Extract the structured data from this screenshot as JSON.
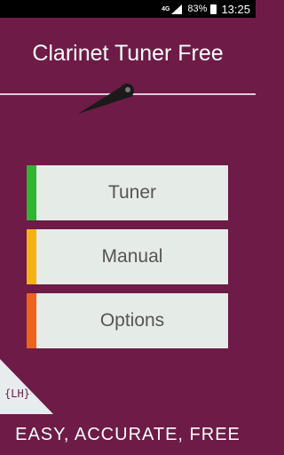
{
  "status_bar": {
    "network": "4G",
    "battery": "83%",
    "time": "13:25"
  },
  "app": {
    "title": "Clarinet Tuner Free"
  },
  "menu": {
    "tuner_label": "Tuner",
    "manual_label": "Manual",
    "options_label": "Options"
  },
  "footer": {
    "logo_text": "{LH}",
    "slogan": "EASY, ACCURATE, FREE"
  },
  "colors": {
    "background": "#6e1b47",
    "tuner_accent": "#2fb52f",
    "manual_accent": "#f5b312",
    "options_accent": "#f0621c"
  }
}
